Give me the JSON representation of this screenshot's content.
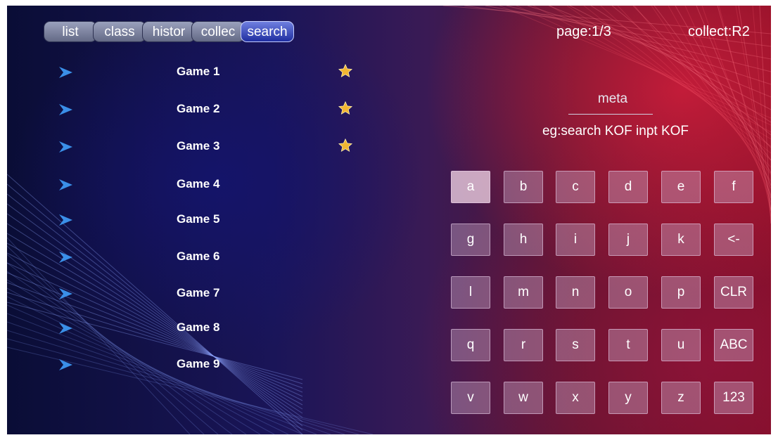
{
  "tabs": [
    {
      "label": "list"
    },
    {
      "label": "class"
    },
    {
      "label": "histor"
    },
    {
      "label": "collec"
    },
    {
      "label": "search",
      "active": true
    }
  ],
  "status": {
    "page": "page:1/3",
    "collect": "collect:R2"
  },
  "games": [
    {
      "name": "Game 1",
      "favorite": true
    },
    {
      "name": "Game 2",
      "favorite": true
    },
    {
      "name": "Game 3",
      "favorite": true
    },
    {
      "name": "Game 4",
      "favorite": false
    },
    {
      "name": "Game 5",
      "favorite": false
    },
    {
      "name": "Game 6",
      "favorite": false
    },
    {
      "name": "Game 7",
      "favorite": false
    },
    {
      "name": "Game 8",
      "favorite": false
    },
    {
      "name": "Game 9",
      "favorite": false
    }
  ],
  "search": {
    "text": "meta",
    "hint": "eg:search KOF inpt KOF"
  },
  "keyboard": {
    "selected": "a",
    "rows": [
      [
        "a",
        "b",
        "c",
        "d",
        "e",
        "f"
      ],
      [
        "g",
        "h",
        "i",
        "j",
        "k",
        "<-"
      ],
      [
        "l",
        "m",
        "n",
        "o",
        "p",
        "CLR"
      ],
      [
        "q",
        "r",
        "s",
        "t",
        "u",
        "ABC"
      ],
      [
        "v",
        "w",
        "x",
        "y",
        "z",
        "123"
      ]
    ]
  },
  "colors": {
    "arrow": "#3a8fe8",
    "star": "#f2b632",
    "tab_active": "#2f3fc0"
  },
  "icons": {
    "row_marker": "arrow-right-icon",
    "favorite": "star-icon"
  }
}
